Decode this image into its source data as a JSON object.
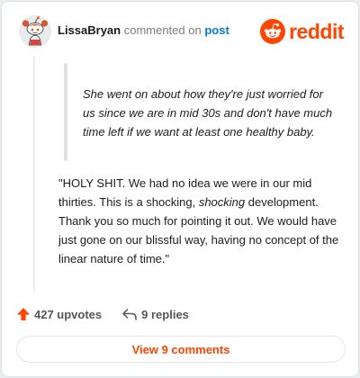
{
  "header": {
    "username": "LissaBryan",
    "action_text": "commented on",
    "post_link": "post",
    "brand_name": "reddit"
  },
  "comment": {
    "quote": "She went on about how they're just worried for us since we are in mid 30s and don't have much time left if we want at least one healthy baby.",
    "body_part1": "\"HOLY SHIT. We had no idea we were in our mid thirties. This is a shocking, ",
    "body_emphasis": "shocking",
    "body_part2": " development. Thank you so much for pointing it out. We would have just gone on our blissful way, having no concept of the linear nature of time.\""
  },
  "actions": {
    "upvotes": "427 upvotes",
    "replies": "9 replies"
  },
  "footer": {
    "view_button": "View 9 comments"
  },
  "colors": {
    "brand": "#ff4500",
    "link": "#0079d3",
    "text": "#1c1c1c",
    "muted": "#7c7c7c"
  },
  "icons": {
    "avatar": "snoo-avatar-icon",
    "brand": "reddit-logo-icon",
    "upvote": "upvote-arrow-icon",
    "reply": "reply-arrow-icon"
  }
}
